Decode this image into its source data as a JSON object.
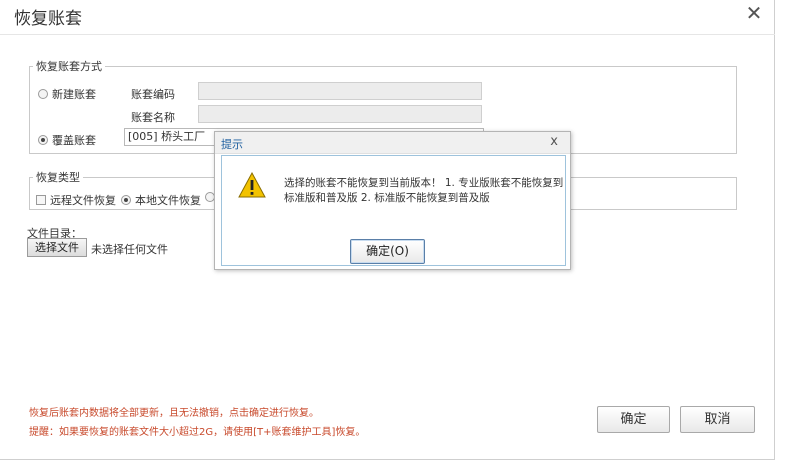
{
  "window": {
    "title": "恢复账套",
    "close_glyph": "✕"
  },
  "restore_method": {
    "legend": "恢复账套方式",
    "new_account_label": "新建账套",
    "account_code_label": "账套编码",
    "account_code_value": "",
    "account_name_label": "账套名称",
    "account_name_value": "",
    "overwrite_label": "覆盖账套",
    "overwrite_value": "[005] 桥头工厂",
    "selected": "overwrite"
  },
  "restore_type": {
    "legend": "恢复类型",
    "remote_label": "远程文件恢复",
    "local_label": "本地文件恢复",
    "selected": "local"
  },
  "file": {
    "dir_label": "文件目录：",
    "choose_button": "选择文件",
    "no_file_text": "未选择任何文件"
  },
  "notes": {
    "line1": "恢复后账套内数据将全部更新，且无法撤销，点击确定进行恢复。",
    "line2": "提醒：如果要恢复的账套文件大小超过2G，请使用[T+账套维护工具]恢复。"
  },
  "buttons": {
    "ok": "确定",
    "cancel": "取消"
  },
  "alert": {
    "title": "提示",
    "close_glyph": "x",
    "message": "选择的账套不能恢复到当前版本！ 1. 专业版账套不能恢复到标准版和普及版 2. 标准版不能恢复到普及版",
    "ok": "确定(O)",
    "icon": "warning-icon"
  },
  "colors": {
    "note_text": "#c84a2c",
    "dialog_title": "#1e5f9f",
    "warning_fill": "#f2c200"
  }
}
